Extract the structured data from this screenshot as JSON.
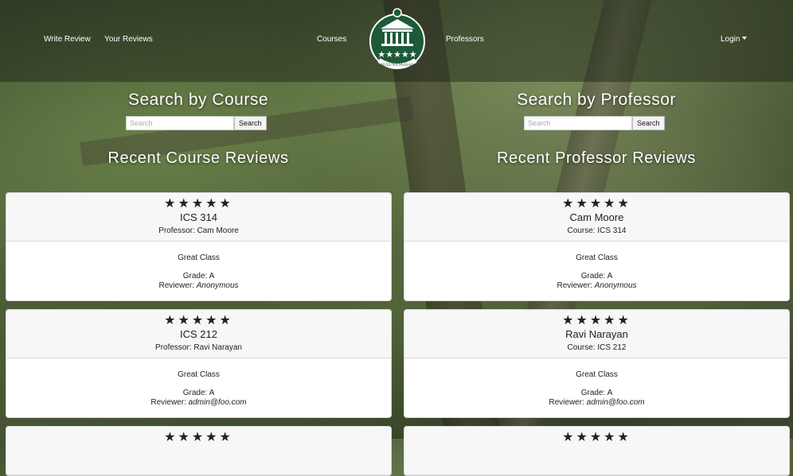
{
  "nav": {
    "write_review": "Write Review",
    "your_reviews": "Your Reviews",
    "courses": "Courses",
    "professors": "Professors",
    "login": "Login",
    "logo_text": "HULUNA MANAO"
  },
  "search": {
    "course_title": "Search by Course",
    "professor_title": "Search by Professor",
    "placeholder": "Search",
    "button": "Search"
  },
  "sections": {
    "recent_course": "Recent Course Reviews",
    "recent_professor": "Recent Professor Reviews"
  },
  "course_reviews": [
    {
      "stars": "★★★★★",
      "title": "ICS 314",
      "sub": "Professor: Cam Moore",
      "comment": "Great Class",
      "grade": "Grade: A",
      "reviewer_label": "Reviewer:",
      "reviewer": "Anonymous"
    },
    {
      "stars": "★★★★★",
      "title": "ICS 212",
      "sub": "Professor: Ravi Narayan",
      "comment": "Great Class",
      "grade": "Grade: A",
      "reviewer_label": "Reviewer:",
      "reviewer": "admin@foo.com"
    },
    {
      "stars": "★★★★★"
    }
  ],
  "professor_reviews": [
    {
      "stars": "★★★★★",
      "title": "Cam Moore",
      "sub": "Course: ICS 314",
      "comment": "Great Class",
      "grade": "Grade: A",
      "reviewer_label": "Reviewer:",
      "reviewer": "Anonymous"
    },
    {
      "stars": "★★★★★",
      "title": "Ravi Narayan",
      "sub": "Course: ICS 212",
      "comment": "Great Class",
      "grade": "Grade: A",
      "reviewer_label": "Reviewer:",
      "reviewer": "admin@foo.com"
    },
    {
      "stars": "★★★★★"
    }
  ],
  "colors": {
    "nav_bg": "#1e2418",
    "card_header": "#f7f7f7",
    "logo_green": "#1d5a37"
  }
}
